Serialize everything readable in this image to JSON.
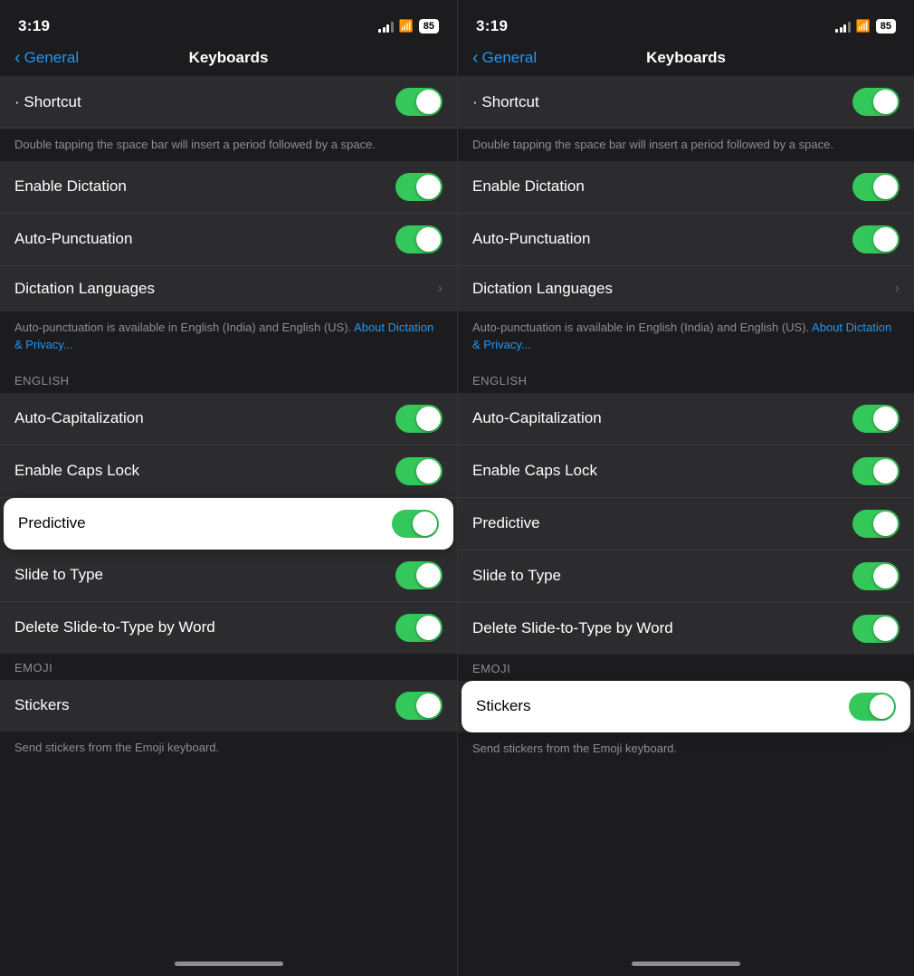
{
  "panels": [
    {
      "id": "left",
      "status": {
        "time": "3:19",
        "battery": "85"
      },
      "nav": {
        "back_label": "General",
        "title": "Keyboards"
      },
      "shortcut_row": {
        "label": "· Shortcut",
        "toggle_on": true
      },
      "shortcut_note": "Double tapping the space bar will insert a period followed by a space.",
      "dictation_section": {
        "rows": [
          {
            "label": "Enable Dictation",
            "toggle_on": true,
            "has_chevron": false
          },
          {
            "label": "Auto-Punctuation",
            "toggle_on": true,
            "has_chevron": false
          },
          {
            "label": "Dictation Languages",
            "toggle_on": false,
            "has_chevron": true
          }
        ],
        "footer": "Auto-punctuation is available in English (India) and English (US).",
        "footer_link": "About Dictation & Privacy..."
      },
      "english_section": {
        "label": "ENGLISH",
        "rows": [
          {
            "label": "Auto-Capitalization",
            "toggle_on": true,
            "highlighted": false
          },
          {
            "label": "Enable Caps Lock",
            "toggle_on": true,
            "highlighted": false
          },
          {
            "label": "Predictive",
            "toggle_on": true,
            "highlighted": true
          },
          {
            "label": "Slide to Type",
            "toggle_on": true,
            "highlighted": false
          },
          {
            "label": "Delete Slide-to-Type by Word",
            "toggle_on": true,
            "highlighted": false
          }
        ]
      },
      "emoji_section": {
        "label": "EMOJI",
        "rows": [
          {
            "label": "Stickers",
            "toggle_on": true,
            "highlighted": false
          }
        ],
        "footer": "Send stickers from the Emoji keyboard."
      }
    },
    {
      "id": "right",
      "status": {
        "time": "3:19",
        "battery": "85"
      },
      "nav": {
        "back_label": "General",
        "title": "Keyboards"
      },
      "shortcut_row": {
        "label": "· Shortcut",
        "toggle_on": true
      },
      "shortcut_note": "Double tapping the space bar will insert a period followed by a space.",
      "dictation_section": {
        "rows": [
          {
            "label": "Enable Dictation",
            "toggle_on": true,
            "has_chevron": false
          },
          {
            "label": "Auto-Punctuation",
            "toggle_on": true,
            "has_chevron": false
          },
          {
            "label": "Dictation Languages",
            "toggle_on": false,
            "has_chevron": true
          }
        ],
        "footer": "Auto-punctuation is available in English (India) and English (US).",
        "footer_link": "About Dictation & Privacy..."
      },
      "english_section": {
        "label": "ENGLISH",
        "rows": [
          {
            "label": "Auto-Capitalization",
            "toggle_on": true,
            "highlighted": false
          },
          {
            "label": "Enable Caps Lock",
            "toggle_on": true,
            "highlighted": false
          },
          {
            "label": "Predictive",
            "toggle_on": true,
            "highlighted": false
          },
          {
            "label": "Slide to Type",
            "toggle_on": true,
            "highlighted": false
          },
          {
            "label": "Delete Slide-to-Type by Word",
            "toggle_on": true,
            "highlighted": false
          }
        ]
      },
      "emoji_section": {
        "label": "EMOJI",
        "rows": [
          {
            "label": "Stickers",
            "toggle_on": true,
            "highlighted": true
          }
        ],
        "footer": "Send stickers from the Emoji keyboard."
      }
    }
  ],
  "colors": {
    "toggle_on": "#34c759",
    "toggle_off": "#636366",
    "accent_blue": "#2196f3",
    "highlight_bg": "#ffffff"
  }
}
